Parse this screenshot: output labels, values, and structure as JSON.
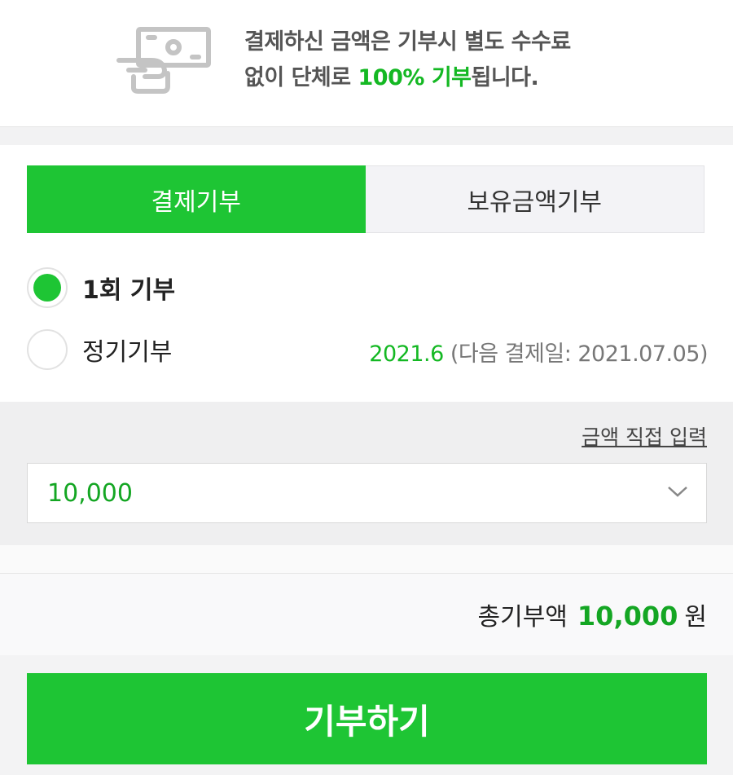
{
  "notice": {
    "line1": "결제하신 금액은 기부시 별도 수수료",
    "line2_prefix": "없이 단체로 ",
    "line2_highlight": "100% 기부",
    "line2_suffix": "됩니다.",
    "icon": "money-hand-icon"
  },
  "tabs": [
    {
      "label": "결제기부",
      "active": true
    },
    {
      "label": "보유금액기부",
      "active": false
    }
  ],
  "options": {
    "once": {
      "label": "1회 기부",
      "selected": true
    },
    "regular": {
      "label": "정기기부",
      "selected": false
    }
  },
  "schedule": {
    "month": "2021.6",
    "next_payment": "(다음 결제일: 2021.07.05)"
  },
  "amount": {
    "direct_input_link": "금액 직접 입력",
    "selected_value": "10,000"
  },
  "total": {
    "label": "총기부액",
    "value": "10,000",
    "unit": "원"
  },
  "action": {
    "donate_label": "기부하기"
  },
  "colors": {
    "accent": "#1ec534",
    "accent_text": "#14a623"
  }
}
